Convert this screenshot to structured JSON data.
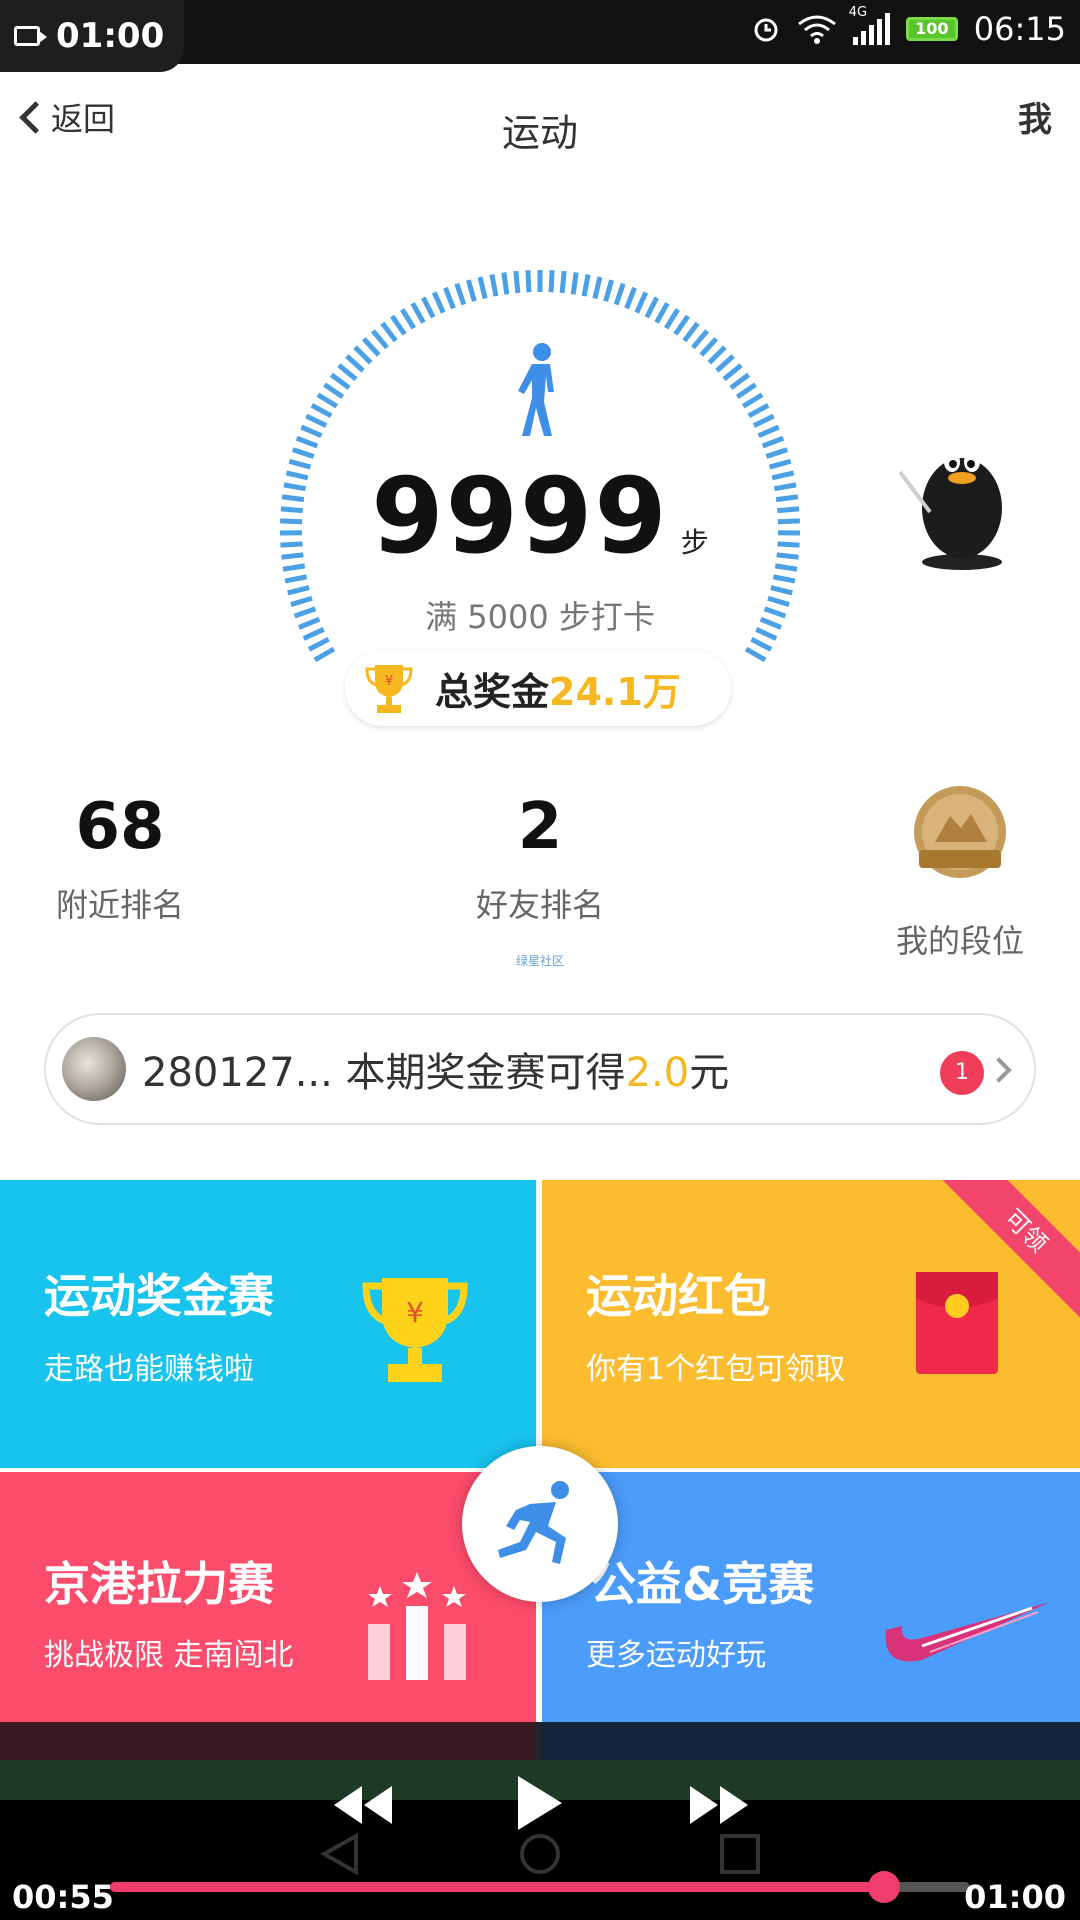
{
  "status_bar": {
    "recording_time": "01:00",
    "clock": "06:15",
    "network": "4G",
    "battery": "100"
  },
  "nav": {
    "back_label": "返回",
    "title": "运动",
    "me_label": "我"
  },
  "activity": {
    "steps": "9999",
    "steps_unit": "步",
    "goal_text": "满 5000 步打卡",
    "prize_label": "总奖金",
    "prize_amount": "24.1万"
  },
  "stats": {
    "nearby_rank_value": "68",
    "nearby_rank_label": "附近排名",
    "friend_rank_value": "2",
    "friend_rank_label": "好友排名",
    "my_tier_label": "我的段位"
  },
  "watermark": "绿星社区",
  "rank_card": {
    "user_text": "280127... 本期奖金赛可得",
    "amount": "2.0",
    "amount_unit": "元",
    "badge_count": "1"
  },
  "tiles": [
    {
      "title": "运动奖金赛",
      "subtitle": "走路也能赚钱啦",
      "color": "#18c3ee"
    },
    {
      "title": "运动红包",
      "subtitle": "你有1个红包可领取",
      "ribbon": "可领",
      "color": "#fbbd2f"
    },
    {
      "title": "京港拉力赛",
      "subtitle": "挑战极限 走南闯北",
      "color": "#fb4c6b"
    },
    {
      "title": "公益&竞赛",
      "subtitle": "更多运动好玩",
      "color": "#4c9cfb"
    }
  ],
  "player": {
    "elapsed": "00:55",
    "total": "01:00",
    "progress": 0.9
  },
  "icons": [
    "walker-icon",
    "trophy-icon",
    "penguin-mascot",
    "medal-icon",
    "red-packet-icon",
    "podium-icon",
    "runner-icon",
    "swoosh-icon",
    "rewind-icon",
    "play-icon",
    "fast-forward-icon"
  ]
}
